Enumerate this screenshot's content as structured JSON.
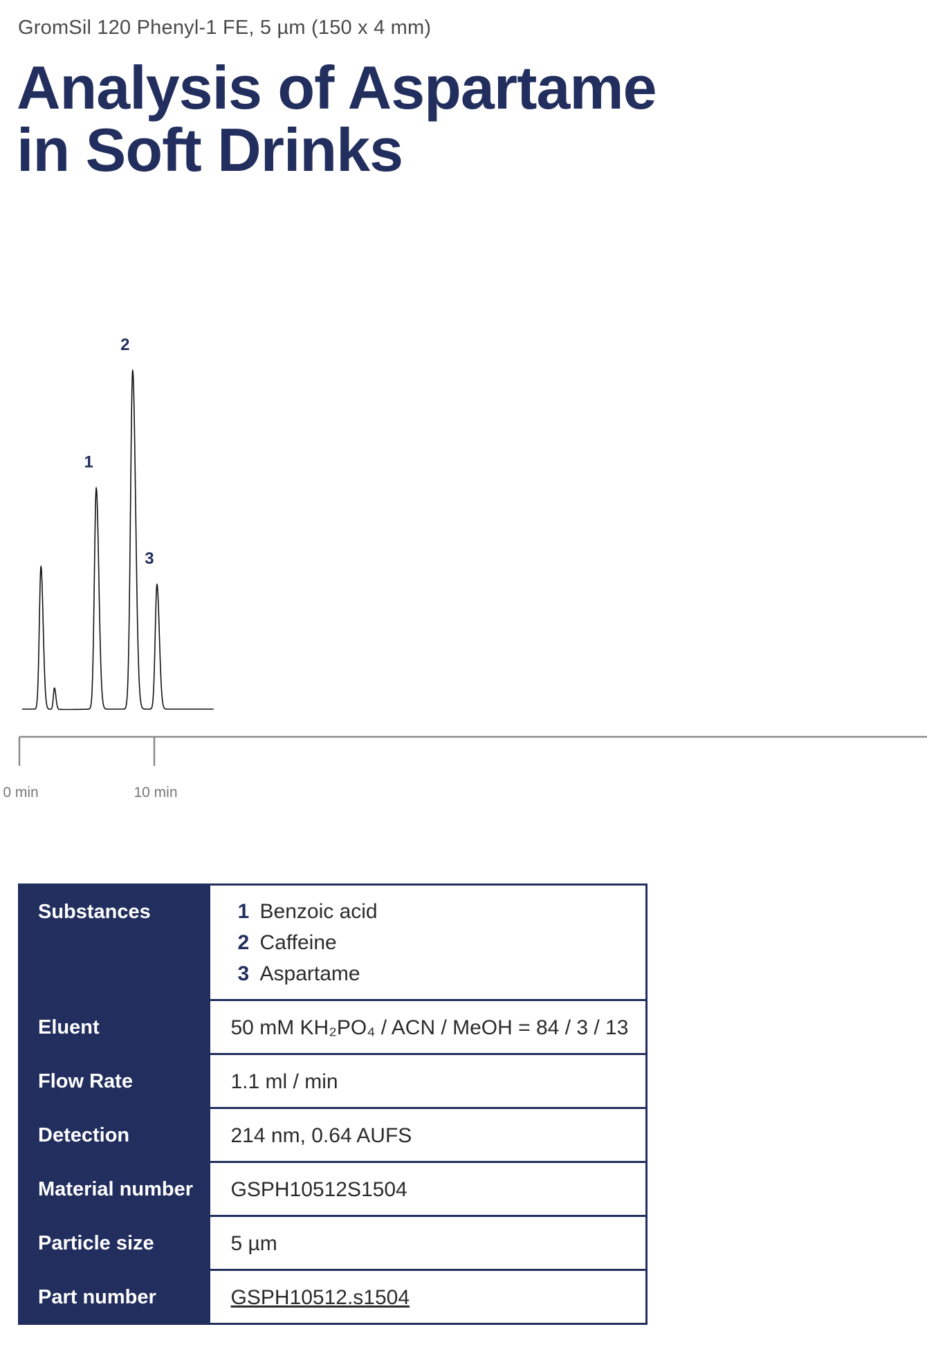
{
  "header": {
    "subtitle": "GromSil 120 Phenyl-1 FE, 5 µm (150 x 4 mm)",
    "title_line1": "Analysis of Aspartame",
    "title_line2": "in Soft Drinks"
  },
  "chart_data": {
    "type": "line",
    "xlabel": "",
    "ylabel": "",
    "xlim": [
      0,
      33
    ],
    "ylim": [
      0,
      100
    ],
    "x_tick_labels": [
      "0 min",
      "10 min"
    ],
    "x_ticks": [
      0,
      10
    ],
    "grid": false,
    "legend": "none",
    "peaks": [
      {
        "label": "",
        "x": 1.6,
        "height": 40
      },
      {
        "label": "",
        "x": 2.6,
        "height": 6
      },
      {
        "label": "1",
        "x": 5.7,
        "height": 62
      },
      {
        "label": "2",
        "x": 8.4,
        "height": 95
      },
      {
        "label": "3",
        "x": 10.2,
        "height": 35
      }
    ],
    "trace_end_min": 14.4,
    "line_color": "#111111",
    "label_color": "#222e5e"
  },
  "table": {
    "rows": [
      {
        "label": "Substances",
        "substances": [
          {
            "num": "1",
            "name": "Benzoic acid"
          },
          {
            "num": "2",
            "name": "Caffeine"
          },
          {
            "num": "3",
            "name": "Aspartame"
          }
        ]
      },
      {
        "label": "Eluent",
        "value": "50 mM KH₂PO₄ / ACN / MeOH = 84 / 3 / 13"
      },
      {
        "label": "Flow Rate",
        "value": "1.1 ml / min"
      },
      {
        "label": "Detection",
        "value": "214 nm, 0.64 AUFS"
      },
      {
        "label": "Material number",
        "value": "GSPH10512S1504"
      },
      {
        "label": "Particle size",
        "value": "5 µm"
      },
      {
        "label": "Part number",
        "value": "GSPH10512.s1504"
      }
    ]
  },
  "colors": {
    "navy": "#222e5e",
    "axis": "#8a8a8a",
    "tick_text": "#777777"
  }
}
